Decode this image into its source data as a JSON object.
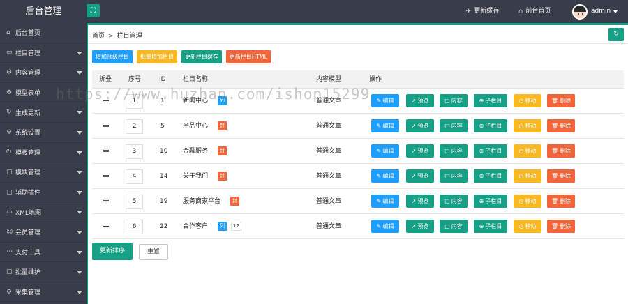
{
  "header": {
    "brand": "后台管理",
    "toggle_icon": "menu-toggle-icon",
    "update_cache": "更新缓存",
    "front_home": "前台首页",
    "user": "admin"
  },
  "sidebar": {
    "items": [
      {
        "label": "后台首页",
        "icon": "home-icon",
        "expandable": false
      },
      {
        "label": "栏目管理",
        "icon": "monitor-icon",
        "expandable": true
      },
      {
        "label": "内容管理",
        "icon": "gear-icon",
        "expandable": true
      },
      {
        "label": "模型表单",
        "icon": "gear-icon",
        "expandable": false
      },
      {
        "label": "生成更新",
        "icon": "refresh-icon",
        "expandable": true
      },
      {
        "label": "系统设置",
        "icon": "settings-icon",
        "expandable": true
      },
      {
        "label": "模板管理",
        "icon": "power-icon",
        "expandable": true
      },
      {
        "label": "模块管理",
        "icon": "folder-icon",
        "expandable": true
      },
      {
        "label": "辅助插件",
        "icon": "folder-icon",
        "expandable": true
      },
      {
        "label": "XML地图",
        "icon": "monitor-icon",
        "expandable": true
      },
      {
        "label": "会员管理",
        "icon": "user-icon",
        "expandable": true
      },
      {
        "label": "支付工具",
        "icon": "dots-icon",
        "expandable": true
      },
      {
        "label": "批量维护",
        "icon": "folder-icon",
        "expandable": true
      },
      {
        "label": "采集管理",
        "icon": "gear-icon",
        "expandable": true
      }
    ]
  },
  "breadcrumb": {
    "home": "首页",
    "separator": ">",
    "current": "栏目管理"
  },
  "toolbar": {
    "add_top": "增加顶级栏目",
    "batch_add": "批量增加栏目",
    "update_cache": "更新栏目缓存",
    "update_html": "更新栏目HTML"
  },
  "table": {
    "headers": {
      "fold": "折叠",
      "order": "序号",
      "id": "ID",
      "name": "栏目名称",
      "model": "内容模型",
      "actions": "操作"
    },
    "rows": [
      {
        "order": "1",
        "id": "1",
        "name": "新闻中心",
        "tag": "列",
        "tag_color": "blue",
        "count": "",
        "model": "普通文章"
      },
      {
        "order": "2",
        "id": "5",
        "name": "产品中心",
        "tag": "封",
        "tag_color": "orange",
        "count": "",
        "model": "普通文章"
      },
      {
        "order": "3",
        "id": "10",
        "name": "金融服务",
        "tag": "封",
        "tag_color": "orange",
        "count": "",
        "model": "普通文章"
      },
      {
        "order": "4",
        "id": "14",
        "name": "关于我们",
        "tag": "封",
        "tag_color": "orange",
        "count": "",
        "model": "普通文章"
      },
      {
        "order": "5",
        "id": "19",
        "name": "服务商家平台",
        "tag": "封",
        "tag_color": "orange",
        "count": "",
        "model": "普通文章"
      },
      {
        "order": "6",
        "id": "22",
        "name": "合作客户",
        "tag": "列",
        "tag_color": "blue",
        "count": "12",
        "model": "普通文章"
      }
    ],
    "actions": {
      "edit": "编辑",
      "preview": "预览",
      "content": "内容",
      "child": "子栏目",
      "move": "移动",
      "delete": "删除"
    }
  },
  "footer": {
    "update_sort": "更新排序",
    "reset": "重置"
  },
  "watermark": "https://www.huzhan.com/ishop15299",
  "colors": {
    "teal": "#16a085",
    "blue": "#1e9fff",
    "yellow": "#f7b824",
    "orange": "#f0663a",
    "dark": "#393d49"
  }
}
